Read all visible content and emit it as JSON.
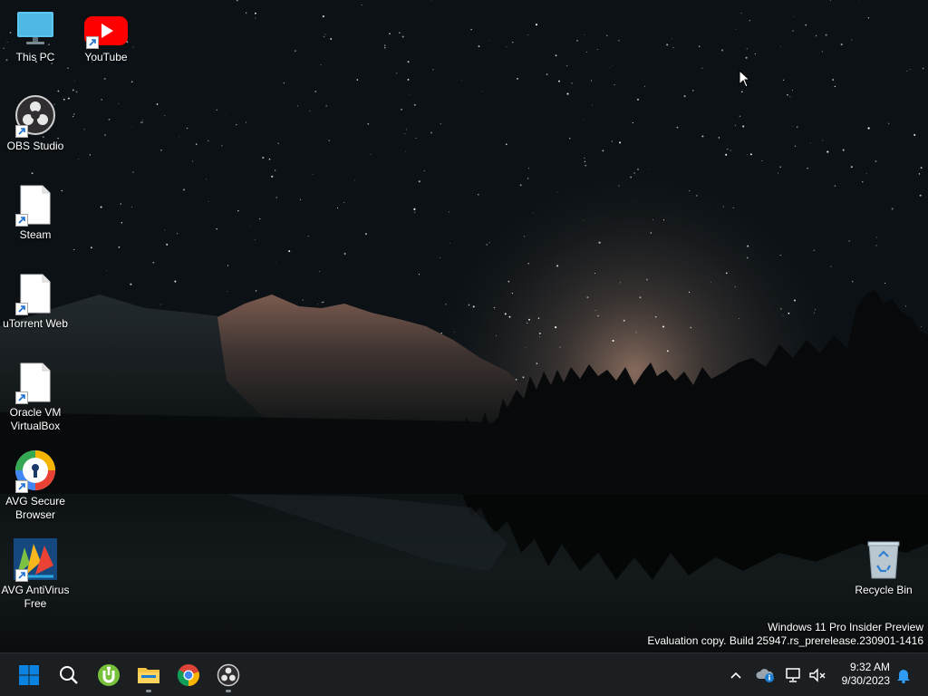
{
  "desktop": {
    "icons": [
      {
        "label": "This PC"
      },
      {
        "label": "YouTube"
      },
      {
        "label": "OBS Studio"
      },
      {
        "label": "Steam"
      },
      {
        "label": "uTorrent Web"
      },
      {
        "label": "Oracle VM\nVirtualBox"
      },
      {
        "label": "AVG Secure\nBrowser"
      },
      {
        "label": "AVG AntiVirus\nFree"
      },
      {
        "label": "Recycle Bin"
      }
    ],
    "watermark": {
      "line1": "Windows 11 Pro Insider Preview",
      "line2": "Evaluation copy. Build 25947.rs_prerelease.230901-1416"
    }
  },
  "taskbar": {
    "apps": [
      "start-icon",
      "search-icon",
      "utorrent-icon",
      "file-explorer-icon",
      "chrome-icon",
      "obs-icon"
    ],
    "clock": {
      "time": "9:32 AM",
      "date": "9/30/2023"
    }
  },
  "colors": {
    "taskbar": "#1c1f22",
    "youtube_red": "#ff0000",
    "win_blue": "#0078d4"
  }
}
